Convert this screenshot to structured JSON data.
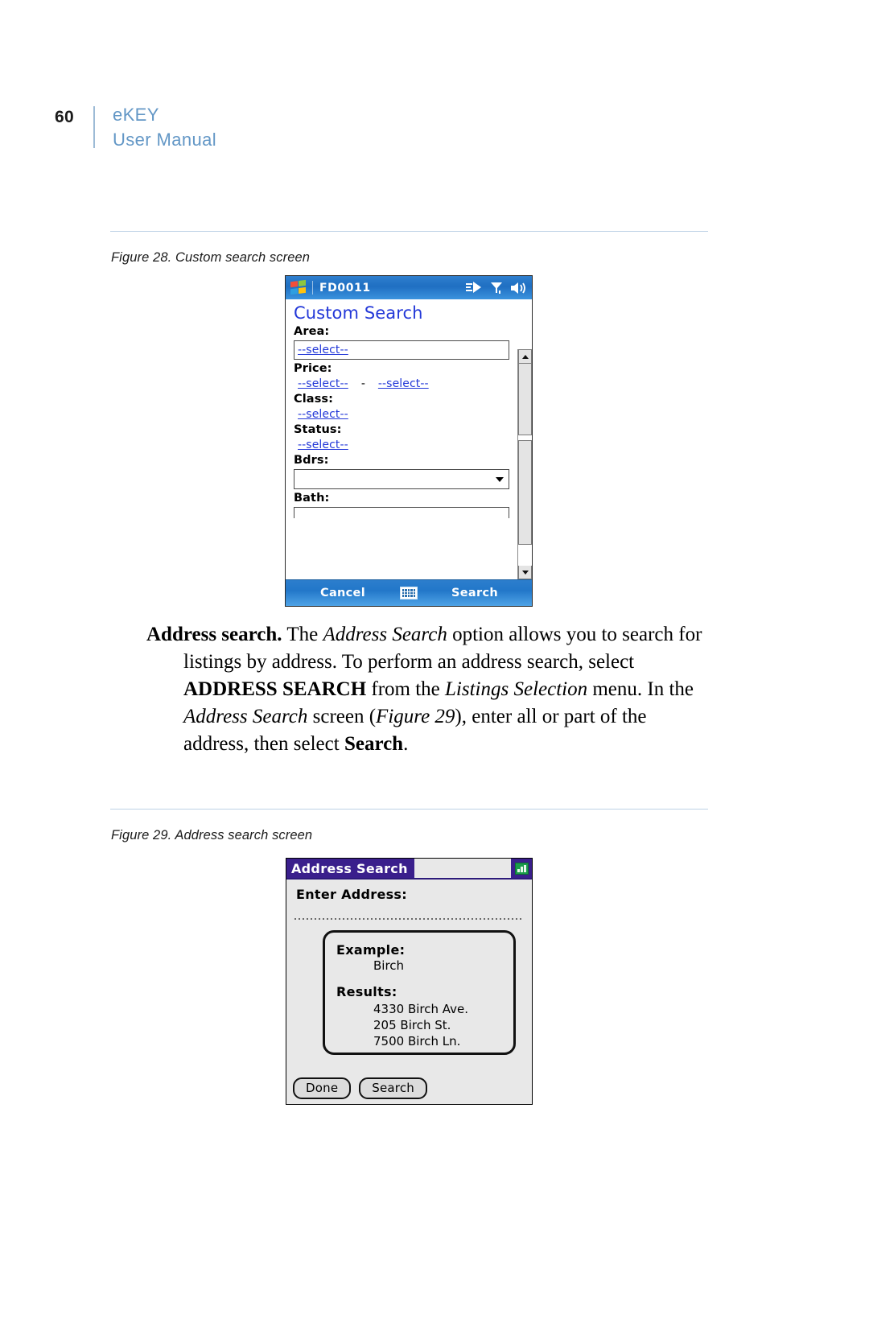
{
  "header": {
    "page_number": "60",
    "title_line_1": "eKEY",
    "title_line_2": "User Manual",
    "accent_color": "#6397c6",
    "rule_color": "#bed2e6"
  },
  "figure_28": {
    "caption": "Figure 28.  Custom search screen",
    "device": {
      "titlebar": {
        "device_name": "FD0011",
        "icons": [
          "windows-flag-icon",
          "connectivity-icon",
          "signal-icon",
          "volume-icon"
        ]
      },
      "heading": "Custom Search",
      "fields": [
        {
          "label": "Area:",
          "control": "textbox",
          "value": "--select--"
        },
        {
          "label": "Price:",
          "control": "link-pair",
          "value_min": "--select--",
          "separator": "-",
          "value_max": "--select--"
        },
        {
          "label": "Class:",
          "control": "link",
          "value": "--select--"
        },
        {
          "label": "Status:",
          "control": "link",
          "value": "--select--"
        },
        {
          "label": "Bdrs:",
          "control": "combobox",
          "value": ""
        },
        {
          "label": "Bath:",
          "control": "combobox",
          "value": ""
        }
      ],
      "scrollbar": {
        "present": true
      },
      "command_bar": {
        "left_label": "Cancel",
        "center_icon": "keyboard-icon",
        "right_label": "Search"
      }
    }
  },
  "paragraph": {
    "segments": [
      {
        "text": "Address search.",
        "style": "bold"
      },
      {
        "text": "  The ",
        "style": "normal"
      },
      {
        "text": "Address Search",
        "style": "italic"
      },
      {
        "text": " option allows you to search for listings by address.  To perform an address search, select ",
        "style": "normal"
      },
      {
        "text": "ADDRESS SEARCH",
        "style": "bold"
      },
      {
        "text": " from the ",
        "style": "normal"
      },
      {
        "text": "Listings Selection",
        "style": "italic"
      },
      {
        "text": " menu.  In the ",
        "style": "normal"
      },
      {
        "text": "Address Search",
        "style": "italic"
      },
      {
        "text": " screen (",
        "style": "normal"
      },
      {
        "text": "Figure 29",
        "style": "italic"
      },
      {
        "text": "), enter all or part of the address, then select ",
        "style": "normal"
      },
      {
        "text": "Search",
        "style": "bold"
      },
      {
        "text": ".",
        "style": "normal"
      }
    ]
  },
  "figure_29": {
    "caption": "Figure 29.  Address search screen",
    "device": {
      "title": "Address Search",
      "home_icon": "home-icon",
      "enter_label": "Enter Address:",
      "example_label": "Example:",
      "example_value": "Birch",
      "results_label": "Results:",
      "results": [
        "4330 Birch Ave.",
        "205 Birch St.",
        "7500 Birch Ln."
      ],
      "buttons": {
        "done_label": "Done",
        "search_label": "Search"
      },
      "title_bar_color": "#3a1f8c"
    }
  }
}
